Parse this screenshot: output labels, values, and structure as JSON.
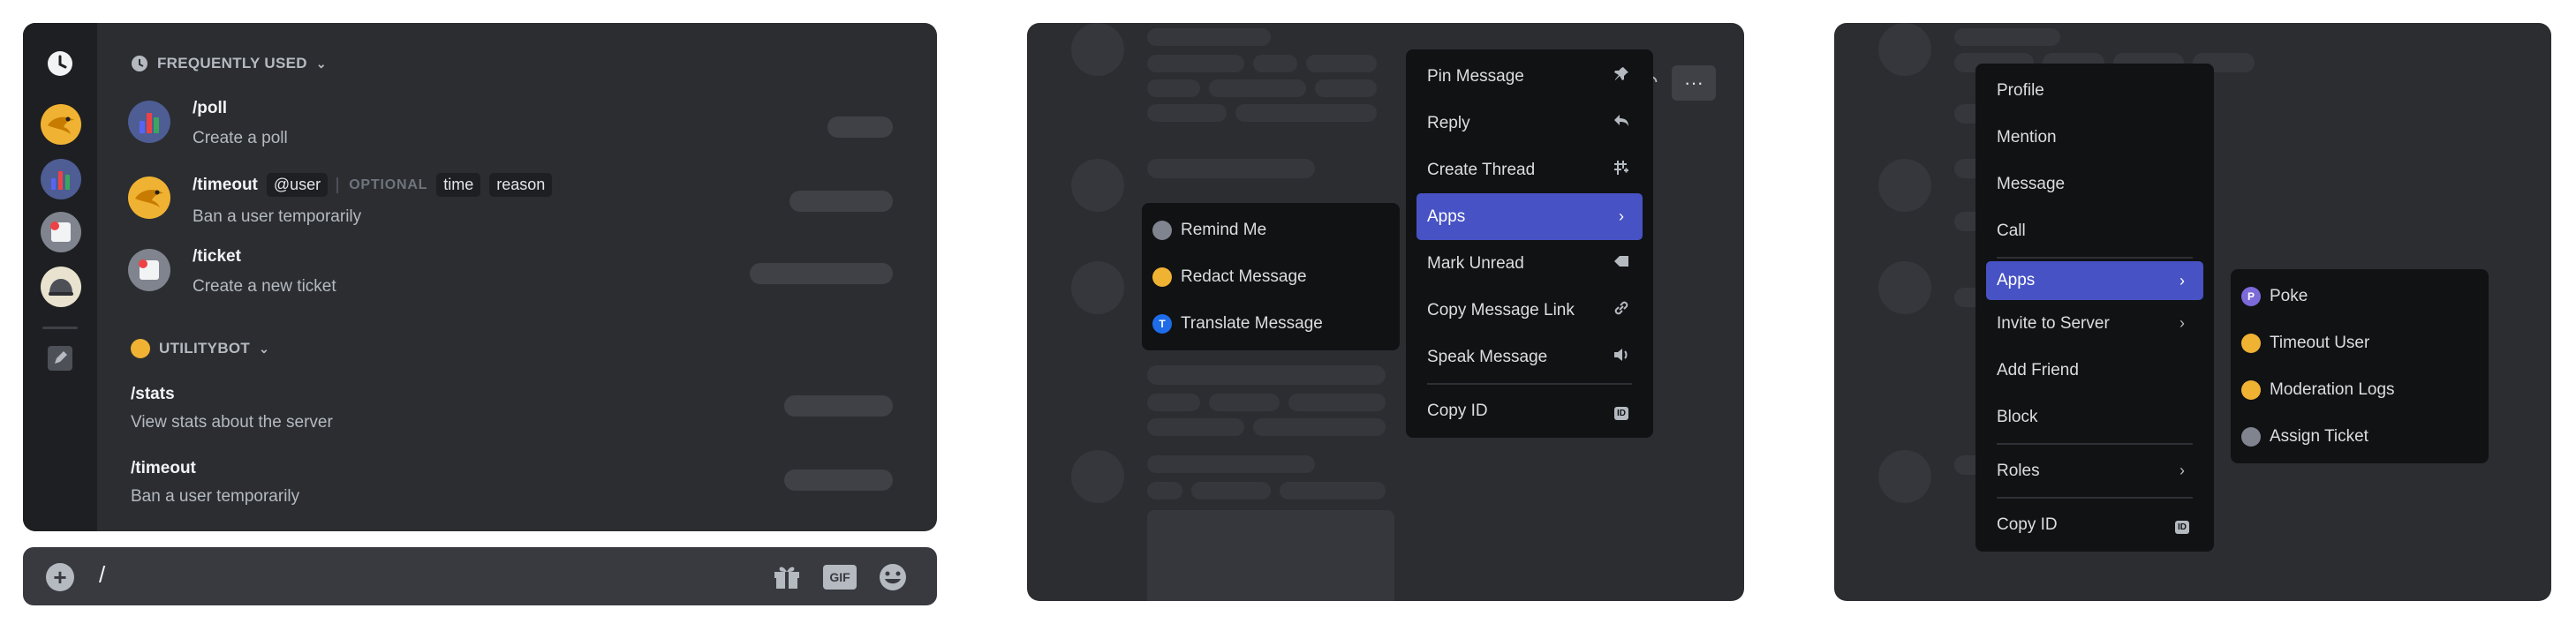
{
  "panel1": {
    "sections": {
      "frequent": {
        "label": "FREQUENTLY USED"
      },
      "bot": {
        "label": "UTILITYBOT"
      }
    },
    "commands": [
      {
        "name": "/poll",
        "desc": "Create a poll"
      },
      {
        "name": "/timeout",
        "arg": "@user",
        "optional_label": "OPTIONAL",
        "opt1": "time",
        "opt2": "reason",
        "desc": "Ban a user temporarily"
      },
      {
        "name": "/ticket",
        "desc": "Create a new ticket"
      },
      {
        "name": "/stats",
        "desc": "View stats about the server"
      },
      {
        "name": "/timeout",
        "desc": "Ban a user temporarily"
      }
    ],
    "chat": {
      "value": "/"
    },
    "gif_label": "GIF"
  },
  "panel2": {
    "menu": [
      {
        "label": "Pin Message",
        "icon": "pin-icon"
      },
      {
        "label": "Reply",
        "icon": "reply-icon"
      },
      {
        "label": "Create Thread",
        "icon": "thread-icon"
      },
      {
        "label": "Apps",
        "icon": "chevron-right-icon"
      },
      {
        "label": "Mark Unread",
        "icon": "unread-icon"
      },
      {
        "label": "Copy Message Link",
        "icon": "link-icon"
      },
      {
        "label": "Speak Message",
        "icon": "speaker-icon"
      },
      {
        "label": "Copy ID",
        "icon": "id-icon"
      }
    ],
    "id_badge": "ID",
    "submenu": [
      {
        "label": "Remind Me"
      },
      {
        "label": "Redact Message"
      },
      {
        "label": "Translate Message",
        "badge": "T"
      }
    ]
  },
  "panel3": {
    "menu": [
      {
        "label": "Profile"
      },
      {
        "label": "Mention"
      },
      {
        "label": "Message"
      },
      {
        "label": "Call"
      },
      {
        "label": "Apps"
      },
      {
        "label": "Invite to Server"
      },
      {
        "label": "Add Friend"
      },
      {
        "label": "Block"
      },
      {
        "label": "Roles"
      },
      {
        "label": "Copy ID"
      }
    ],
    "id_badge": "ID",
    "submenu": [
      {
        "label": "Poke",
        "badge": "P"
      },
      {
        "label": "Timeout User"
      },
      {
        "label": "Moderation Logs"
      },
      {
        "label": "Assign Ticket"
      }
    ]
  },
  "colors": {
    "accent": "#4752c4",
    "panel": "#2b2d31",
    "menu": "#111214"
  }
}
